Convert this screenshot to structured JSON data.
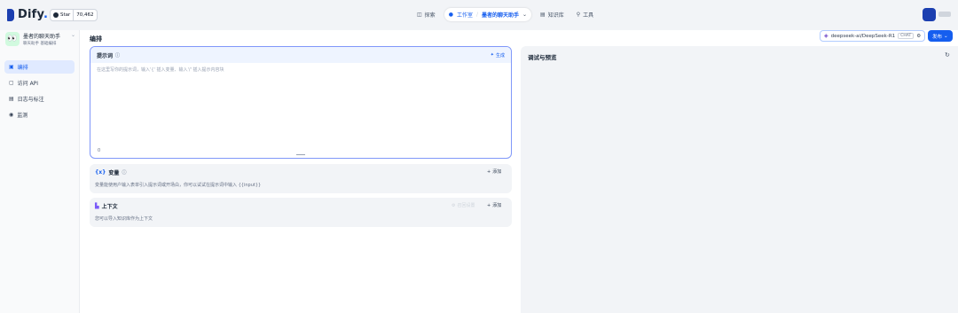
{
  "header": {
    "logo_text": "Dify",
    "logo_suffix": ".",
    "github_star_label": "Star",
    "github_star_count": "70,462",
    "nav": [
      {
        "label": "探索",
        "icon": "explore-icon"
      },
      {
        "label": "工作室",
        "icon": "studio-icon",
        "active": true
      },
      {
        "label": "知识库",
        "icon": "knowledge-icon"
      },
      {
        "label": "工具",
        "icon": "tools-icon"
      }
    ],
    "current_app": "墨者的聊天助手"
  },
  "sidebar": {
    "app_name": "墨者的聊天助手",
    "app_type": "聊天助手",
    "app_mode": "基础编排",
    "items": [
      {
        "label": "编排",
        "icon": "orchestrate-icon",
        "active": true
      },
      {
        "label": "访问 API",
        "icon": "api-icon"
      },
      {
        "label": "日志与标注",
        "icon": "logs-icon"
      },
      {
        "label": "监测",
        "icon": "monitor-icon"
      }
    ]
  },
  "main": {
    "title": "编排",
    "model_name": "deepseek-ai/DeepSeek-R1",
    "model_badge": "CHAT",
    "publish_label": "发布",
    "prompt": {
      "label": "提示词",
      "generate_label": "生成",
      "placeholder": "在这里写你的提示词，输入'{' 插入变量、输入'/' 插入提示内容块",
      "char_count": "0"
    },
    "variables": {
      "label": "变量",
      "add_label": "添加",
      "description": "变量能使用户输入表单引入提示词或开场白，你可以试试在提示词中输入 {{input}}"
    },
    "context": {
      "label": "上下文",
      "recall_label": "召回设置",
      "add_label": "添加",
      "description": "您可以导入知识库作为上下文"
    },
    "preview": {
      "title": "调试与预览"
    }
  },
  "colors": {
    "accent": "#155eef",
    "prompt_border": "#8098f9",
    "active_menu_bg": "#e0eaff"
  }
}
